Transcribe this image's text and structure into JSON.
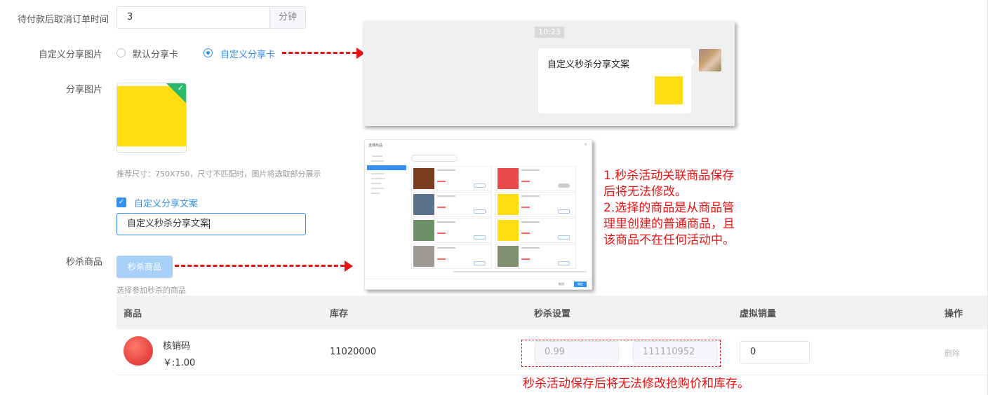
{
  "form": {
    "cancel_time": {
      "label": "待付款后取消订单时间",
      "value": "3",
      "unit": "分钟"
    },
    "share_image_type": {
      "label": "自定义分享图片",
      "option_default": "默认分享卡",
      "option_custom": "自定义分享卡",
      "selected": "自定义分享卡"
    },
    "share_image": {
      "label": "分享图片",
      "hint": "推荐尺寸：750X750，尺寸不匹配时，图片将选取部分展示"
    },
    "share_text": {
      "checkbox_label": "自定义分享文案",
      "checked": true,
      "value": "自定义秒杀分享文案"
    },
    "seckill_goods": {
      "label": "秒杀商品",
      "button": "秒杀商品",
      "hint": "选择参加秒杀的商品"
    }
  },
  "chat_preview": {
    "time": "10:23",
    "message": "自定义秒杀分享文案"
  },
  "picker_preview": {
    "title": "选择商品",
    "footer_cancel": "取消",
    "footer_ok": "确定"
  },
  "table": {
    "headers": [
      "商品",
      "库存",
      "秒杀设置",
      "虚拟销量",
      "操作"
    ],
    "rows": [
      {
        "name": "核销码",
        "price": "￥:1.00",
        "stock": "11020000",
        "seckill_price": "0.99",
        "seckill_stock": "111110952",
        "virtual_sales": "0",
        "action": "删除"
      }
    ]
  },
  "annotations": {
    "note_lines": [
      "1.秒杀活动关联商品保存",
      "后将无法修改。",
      "2.选择的商品是从商品管",
      "理里创建的普通商品，且",
      "该商品不在任何活动中。"
    ],
    "note_bottom": "秒杀活动保存后将无法修改抢购价和库存。"
  },
  "colors": {
    "accent": "#3390f0",
    "annotation": "#ee1111",
    "thumb_yellow": "#ffdd11",
    "badge_green": "#2bb86b"
  }
}
